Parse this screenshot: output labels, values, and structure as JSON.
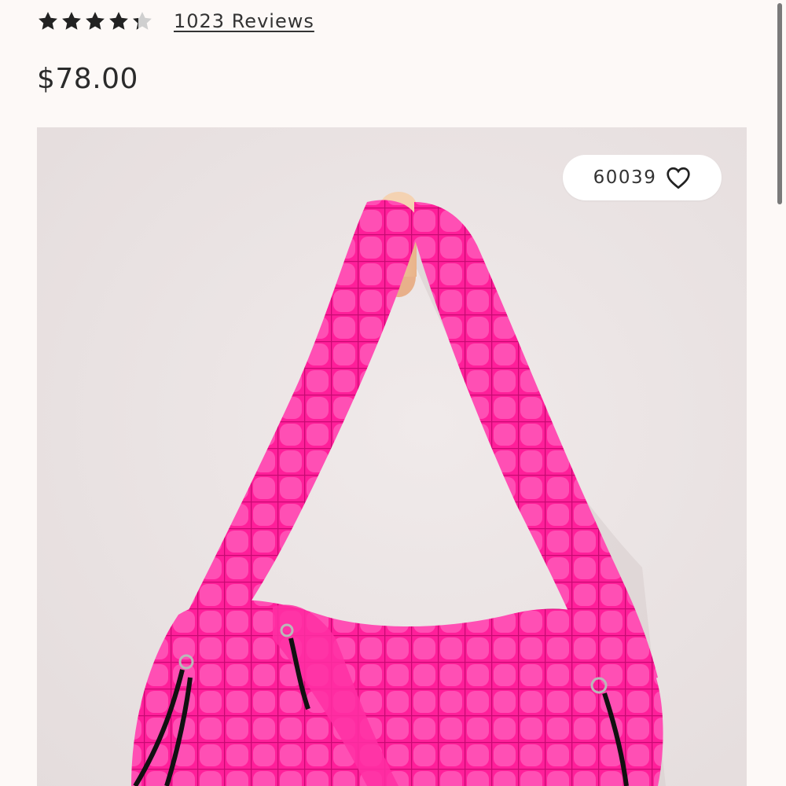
{
  "rating": {
    "value": 4.5,
    "max": 5,
    "filled_color": "#222222",
    "empty_color": "#cfcfcf",
    "reviews_label": "1023 Reviews"
  },
  "price": "$78.00",
  "product_image": {
    "description_icon": "product-photo",
    "favorites_count": "60039",
    "favorite_icon": "heart-outline-icon",
    "background_color": "#ebe5e4",
    "bag_color": "#ff1f9a"
  }
}
